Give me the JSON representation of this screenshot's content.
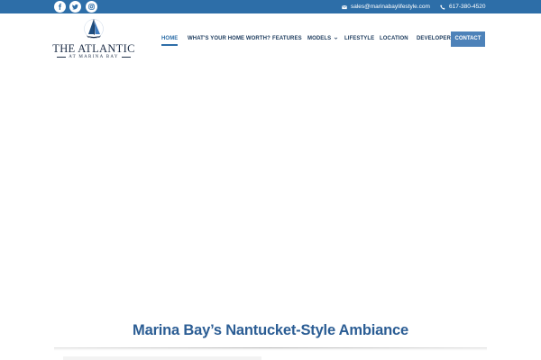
{
  "topbar": {
    "social": [
      {
        "icon": "facebook-icon",
        "label": "f"
      },
      {
        "icon": "twitter-icon",
        "label": "t"
      },
      {
        "icon": "instagram-icon",
        "label": "i"
      }
    ],
    "email": "sales@marinabaylifestyle.com",
    "phone": "617-380-4520"
  },
  "logo": {
    "title": "THE ATLANTIC",
    "subtitle": "AT MARINA BAY"
  },
  "nav": {
    "items": [
      {
        "label": "HOME",
        "active": true
      },
      {
        "label": "WHAT'S YOUR HOME WORTH?"
      },
      {
        "label": "FEATURES"
      },
      {
        "label": "MODELS",
        "dropdown": true
      },
      {
        "label": "LIFESTYLE"
      },
      {
        "label": "LOCATION"
      },
      {
        "label": "DEVELOPER"
      }
    ],
    "cta": "CONTACT"
  },
  "hero": {
    "headline": "Marina Bay’s Nantucket-Style Ambiance"
  },
  "colors": {
    "primary": "#2d6ea8",
    "nav_text": "#1b3a5c",
    "cta_bg": "#4d82b9",
    "headline": "#2b5d94"
  }
}
